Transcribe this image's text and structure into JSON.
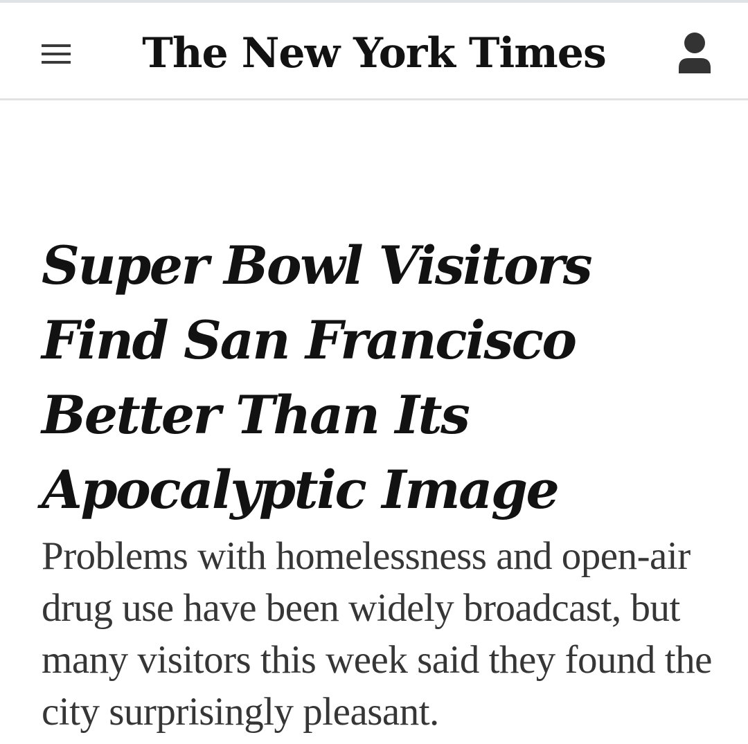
{
  "header": {
    "masthead": "The New York Times",
    "menu_icon": "hamburger-menu-icon",
    "account_icon": "account-user-icon"
  },
  "article": {
    "headline": "Super Bowl Visitors Find San Francisco Better Than Its Apocalyptic Image",
    "summary": "Problems with homelessness and open-air drug use have been widely broadcast, but many visitors this week said they found the city surprisingly pleasant."
  },
  "colors": {
    "text_primary": "#121212",
    "text_secondary": "#363636",
    "divider": "#e2e2e2",
    "background": "#ffffff"
  }
}
